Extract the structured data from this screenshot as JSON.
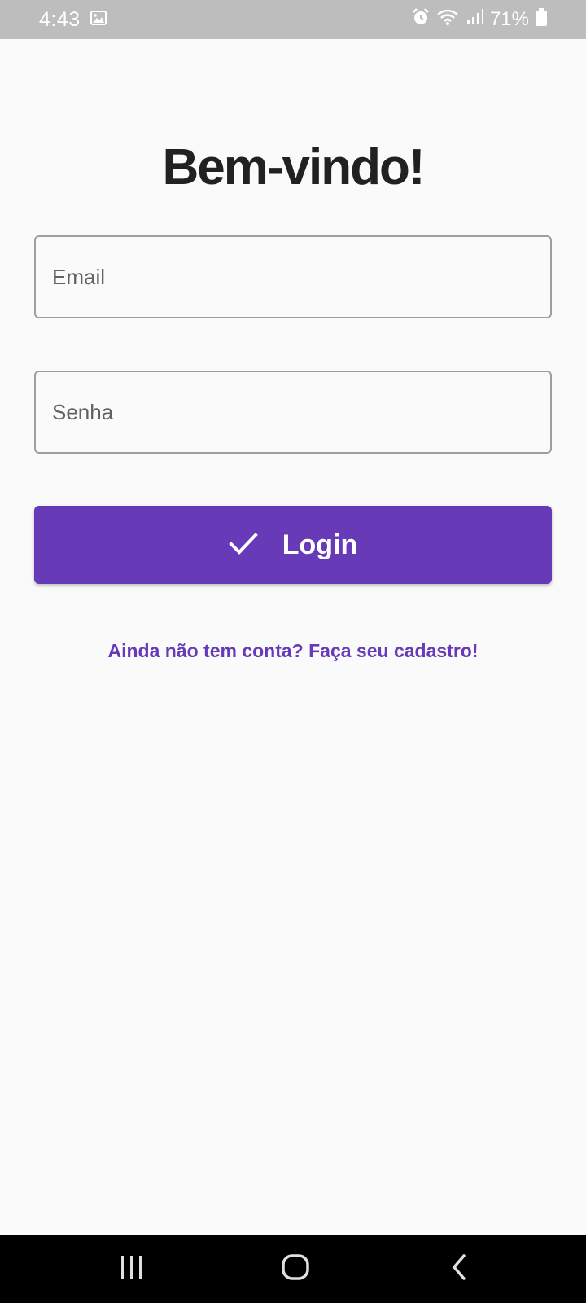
{
  "status_bar": {
    "time": "4:43",
    "battery_percent": "71%",
    "icons": [
      "image-icon",
      "alarm-icon",
      "wifi-icon",
      "signal-icon",
      "battery-icon"
    ]
  },
  "login": {
    "title": "Bem-vindo!",
    "email_placeholder": "Email",
    "password_placeholder": "Senha",
    "login_button_label": "Login",
    "login_button_icon": "check-icon",
    "signup_link": "Ainda não tem conta? Faça seu cadastro!"
  },
  "navigation": {
    "buttons": [
      "recents-icon",
      "home-icon",
      "back-icon"
    ]
  },
  "colors": {
    "primary": "#673ab7",
    "background": "#fafafa",
    "title_text": "#212121",
    "field_border": "#9e9e9e",
    "status_bar": "#bdbdbd",
    "nav_bar": "#000000"
  }
}
